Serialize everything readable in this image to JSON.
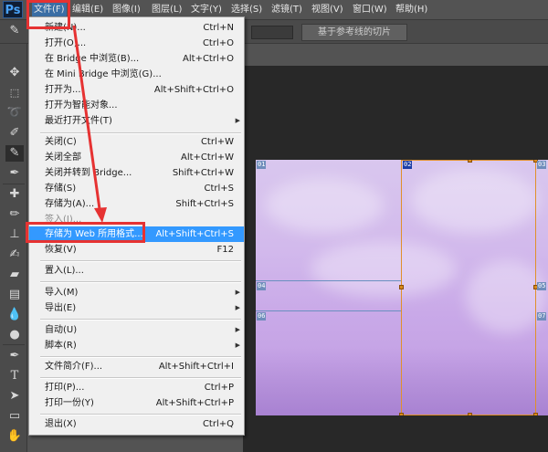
{
  "app": {
    "logo": "Ps"
  },
  "menubar": {
    "items": [
      {
        "label": "文件(F)"
      },
      {
        "label": "编辑(E)"
      },
      {
        "label": "图像(I)"
      },
      {
        "label": "图层(L)"
      },
      {
        "label": "文字(Y)"
      },
      {
        "label": "选择(S)"
      },
      {
        "label": "滤镜(T)"
      },
      {
        "label": "视图(V)"
      },
      {
        "label": "窗口(W)"
      },
      {
        "label": "帮助(H)"
      }
    ]
  },
  "options_bar": {
    "slice_button": "基于参考线的切片"
  },
  "file_menu": {
    "items": [
      {
        "label": "新建(N)...",
        "shortcut": "Ctrl+N"
      },
      {
        "label": "打开(O)...",
        "shortcut": "Ctrl+O"
      },
      {
        "label": "在 Bridge 中浏览(B)...",
        "shortcut": "Alt+Ctrl+O"
      },
      {
        "label": "在 Mini Bridge 中浏览(G)...",
        "shortcut": ""
      },
      {
        "label": "打开为...",
        "shortcut": "Alt+Shift+Ctrl+O"
      },
      {
        "label": "打开为智能对象...",
        "shortcut": ""
      },
      {
        "label": "最近打开文件(T)",
        "shortcut": ""
      },
      {
        "label": "关闭(C)",
        "shortcut": "Ctrl+W"
      },
      {
        "label": "关闭全部",
        "shortcut": "Alt+Ctrl+W"
      },
      {
        "label": "关闭并转到 Bridge...",
        "shortcut": "Shift+Ctrl+W"
      },
      {
        "label": "存储(S)",
        "shortcut": "Ctrl+S"
      },
      {
        "label": "存储为(A)...",
        "shortcut": "Shift+Ctrl+S"
      },
      {
        "label": "签入(I)...",
        "shortcut": ""
      },
      {
        "label": "存储为 Web 所用格式...",
        "shortcut": "Alt+Shift+Ctrl+S"
      },
      {
        "label": "恢复(V)",
        "shortcut": "F12"
      },
      {
        "label": "置入(L)...",
        "shortcut": ""
      },
      {
        "label": "导入(M)",
        "shortcut": ""
      },
      {
        "label": "导出(E)",
        "shortcut": ""
      },
      {
        "label": "自动(U)",
        "shortcut": ""
      },
      {
        "label": "脚本(R)",
        "shortcut": ""
      },
      {
        "label": "文件简介(F)...",
        "shortcut": "Alt+Shift+Ctrl+I"
      },
      {
        "label": "打印(P)...",
        "shortcut": "Ctrl+P"
      },
      {
        "label": "打印一份(Y)",
        "shortcut": "Alt+Shift+Ctrl+P"
      },
      {
        "label": "退出(X)",
        "shortcut": "Ctrl+Q"
      }
    ]
  },
  "canvas": {
    "slice_tags": [
      "01",
      "02",
      "03",
      "04",
      "05",
      "06",
      "07"
    ]
  },
  "colors": {
    "annotation_red": "#e63232",
    "menu_highlight": "#3399ff",
    "slice_selected": "#e0902a"
  }
}
